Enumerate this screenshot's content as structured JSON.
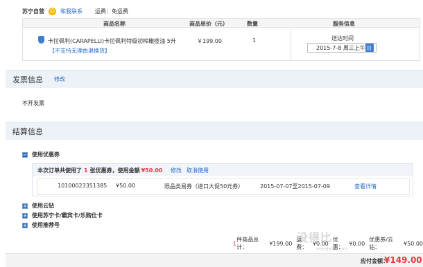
{
  "store": {
    "name": "苏宁自营",
    "contact_label": "和我联系",
    "shipping_text": "运费：免运费"
  },
  "products_table": {
    "headers": {
      "name": "商品名称",
      "unit_price": "商品单价（元）",
      "quantity": "数量",
      "service": "服务信息"
    },
    "item": {
      "name": "卡拉佩利(CARAPELLI)卡拉佩利特级初榨橄榄油 5升",
      "return_note": "【不支持无理由退换货】",
      "price": "￥199.00",
      "quantity": "1",
      "delivery_label": "送达时间",
      "delivery_date": "2015-7-8 周三上午"
    }
  },
  "invoice": {
    "title": "发票信息",
    "edit_label": "修改",
    "value": "不开发票"
  },
  "settlement": {
    "title": "结算信息",
    "coupon_toggle_label": "使用优惠券",
    "coupon_summary": {
      "prefix": "本次订单共使用了",
      "count": "1",
      "suffix": "张优惠券，使用金额",
      "amount": "¥50.00",
      "edit_label": "修改",
      "cancel_label": "取消使用"
    },
    "coupon": {
      "id": "10100023351385",
      "value": "¥50.00",
      "description": "限品类易券（进口大促50元券）",
      "valid_range": "2015-07-07至2015-07-09",
      "detail_label": "查看详情"
    },
    "other_options": [
      "使用云钻",
      "使用苏宁卡/霸宾卡/乐购仕卡",
      "使用推荐号"
    ]
  },
  "totals": {
    "count": "1",
    "goods_total_label": "件商品总计：",
    "goods_total": "¥199.00",
    "freight_label": "运费：",
    "freight": "¥0.00",
    "discount_label": "优惠：",
    "discount": "¥0.00",
    "coupon_cloud_label": "优惠券/云钻：",
    "coupon_cloud": "¥50.00",
    "payable_label": "应付金额：",
    "payable": "¥149.00"
  },
  "watermark": {
    "text": "没得比",
    "sub": "meidebi.com"
  },
  "colors": {
    "link": "#2a6cc4",
    "price_red": "#e4393c",
    "section_bg": "#edf2f8"
  }
}
